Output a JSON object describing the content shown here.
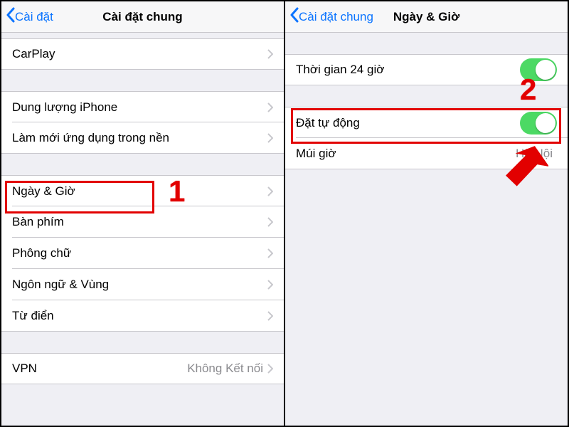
{
  "left": {
    "back": "Cài đặt",
    "title": "Cài đặt chung",
    "carplay": "CarPlay",
    "storage": "Dung lượng iPhone",
    "bg_refresh": "Làm mới ứng dụng trong nền",
    "date_time": "Ngày & Giờ",
    "keyboard": "Bàn phím",
    "fonts": "Phông chữ",
    "lang_region": "Ngôn ngữ & Vùng",
    "dictionary": "Từ điển",
    "vpn": "VPN",
    "vpn_status": "Không Kết nối"
  },
  "right": {
    "back": "Cài đặt chung",
    "title": "Ngày & Giờ",
    "time24h": "Thời gian 24 giờ",
    "set_auto": "Đặt tự động",
    "timezone": "Múi giờ",
    "timezone_value": "Hà Nội"
  },
  "annotations": {
    "step1": "1",
    "step2": "2"
  }
}
